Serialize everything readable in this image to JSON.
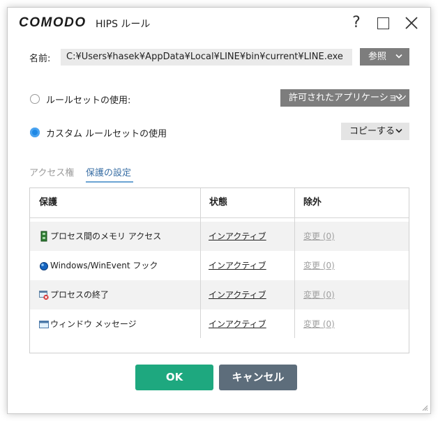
{
  "window": {
    "brand": "COMODO",
    "title": "HIPS ルール",
    "help_label": "?"
  },
  "name_row": {
    "label": "名前:",
    "value": "C:¥Users¥hasek¥AppData¥Local¥LINE¥bin¥current¥LINE.exe",
    "browse_label": "参照"
  },
  "ruleset": {
    "use_ruleset_label": "ルールセットの使用:",
    "ruleset_select": "許可されたアプリケーション",
    "use_custom_label": "カスタム ルールセットの使用",
    "copy_label": "コピーする",
    "selected": "custom"
  },
  "tabs": [
    {
      "label": "アクセス権",
      "active": false
    },
    {
      "label": "保護の設定",
      "active": true
    }
  ],
  "table": {
    "columns": [
      "保護",
      "状態",
      "除外"
    ],
    "rows": [
      {
        "icon": "process-memory-icon",
        "name": "プロセス間のメモリ アクセス",
        "status": "インアクティブ",
        "exclusion": "変更 (0)"
      },
      {
        "icon": "windows-hook-icon",
        "name": "Windows/WinEvent フック",
        "status": "インアクティブ",
        "exclusion": "変更 (0)"
      },
      {
        "icon": "process-terminate-icon",
        "name": "プロセスの終了",
        "status": "インアクティブ",
        "exclusion": "変更 (0)"
      },
      {
        "icon": "window-message-icon",
        "name": "ウィンドウ メッセージ",
        "status": "インアクティブ",
        "exclusion": "変更 (0)"
      }
    ]
  },
  "footer": {
    "ok_label": "OK",
    "cancel_label": "キャンセル"
  },
  "colors": {
    "ok": "#1ea87f",
    "cancel": "#5d6d7b",
    "accent_blue": "#1e88e5",
    "gray_button": "#7d7d7d"
  }
}
